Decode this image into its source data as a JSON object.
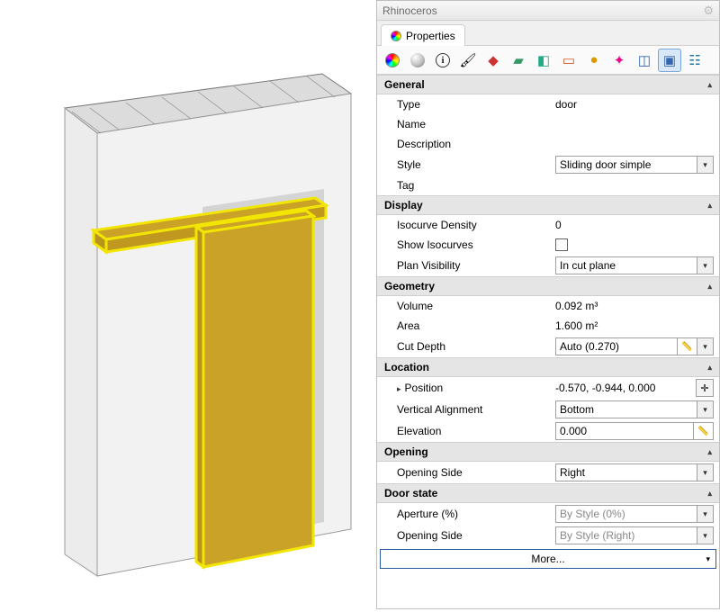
{
  "window": {
    "title": "Rhinoceros"
  },
  "tab": {
    "label": "Properties"
  },
  "toolbar": {
    "items": [
      {
        "name": "object-properties-icon"
      },
      {
        "name": "material-icon"
      },
      {
        "name": "info-icon"
      },
      {
        "name": "texture-mapping-icon"
      },
      {
        "name": "decals-icon"
      },
      {
        "name": "render-icon"
      },
      {
        "name": "door-icon"
      },
      {
        "name": "window-icon"
      },
      {
        "name": "element-icon"
      },
      {
        "name": "sun-icon"
      },
      {
        "name": "section-icon"
      },
      {
        "name": "visualarq-icon",
        "selected": true
      },
      {
        "name": "layers-icon"
      }
    ]
  },
  "sections": {
    "general": {
      "title": "General",
      "type_label": "Type",
      "type_value": "door",
      "name_label": "Name",
      "name_value": "",
      "desc_label": "Description",
      "desc_value": "",
      "style_label": "Style",
      "style_value": "Sliding door simple",
      "tag_label": "Tag",
      "tag_value": ""
    },
    "display": {
      "title": "Display",
      "iso_density_label": "Isocurve Density",
      "iso_density_value": "0",
      "show_iso_label": "Show Isocurves",
      "show_iso_checked": false,
      "planvis_label": "Plan Visibility",
      "planvis_value": "In cut plane"
    },
    "geometry": {
      "title": "Geometry",
      "volume_label": "Volume",
      "volume_value": "0.092 m³",
      "area_label": "Area",
      "area_value": "1.600 m²",
      "cutdepth_label": "Cut Depth",
      "cutdepth_value": "Auto (0.270)"
    },
    "location": {
      "title": "Location",
      "position_label": "Position",
      "position_value": "-0.570, -0.944, 0.000",
      "valign_label": "Vertical Alignment",
      "valign_value": "Bottom",
      "elev_label": "Elevation",
      "elev_value": "0.000"
    },
    "opening": {
      "title": "Opening",
      "side_label": "Opening Side",
      "side_value": "Right"
    },
    "doorstate": {
      "title": "Door state",
      "aperture_label": "Aperture (%)",
      "aperture_value": "By Style (0%)",
      "side_label": "Opening Side",
      "side_value": "By Style (Right)"
    }
  },
  "more_label": "More..."
}
